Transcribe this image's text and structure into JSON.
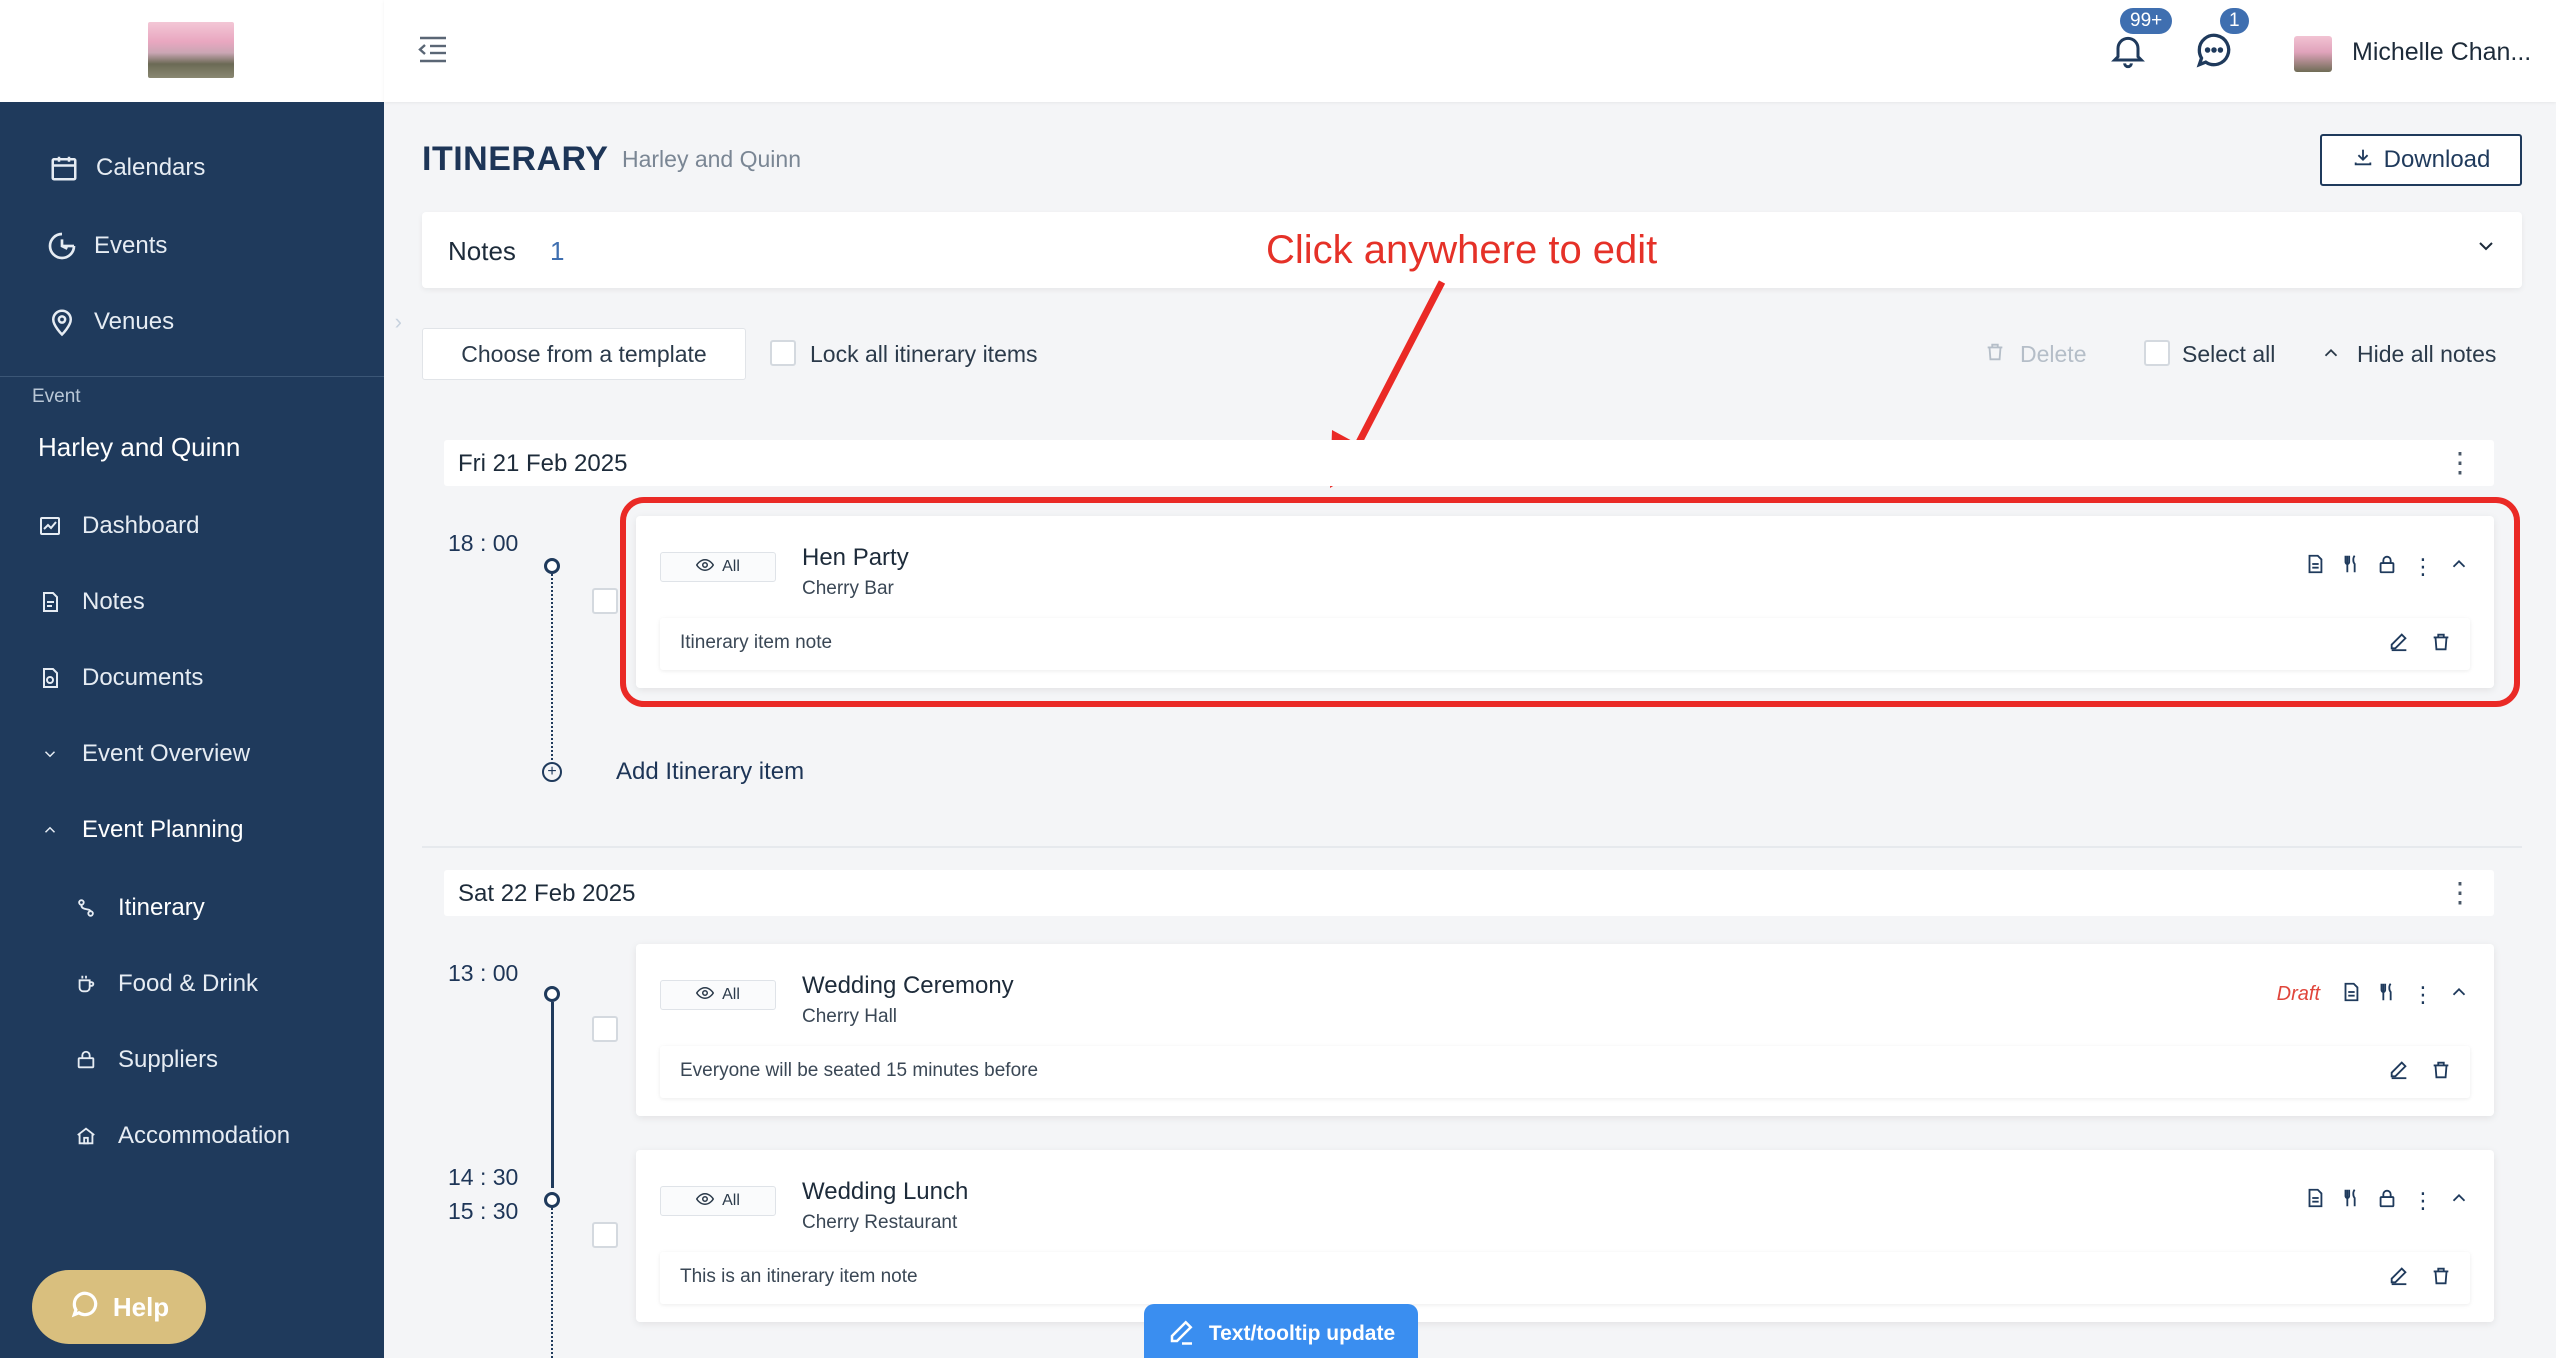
{
  "sidebar": {
    "nav": [
      {
        "label": "Calendars",
        "icon": "calendar-icon"
      },
      {
        "label": "Events",
        "icon": "events-icon"
      },
      {
        "label": "Venues",
        "icon": "location-pin-icon"
      }
    ],
    "section_label": "Event",
    "event_name": "Harley and Quinn",
    "event_nav": [
      {
        "label": "Dashboard",
        "icon": "dashboard-icon"
      },
      {
        "label": "Notes",
        "icon": "notes-icon"
      },
      {
        "label": "Documents",
        "icon": "documents-icon"
      },
      {
        "label": "Event Overview",
        "icon": "chevron-down-icon"
      },
      {
        "label": "Event Planning",
        "icon": "chevron-up-icon"
      }
    ],
    "planning_sub": [
      {
        "label": "Itinerary",
        "icon": "itinerary-icon"
      },
      {
        "label": "Food & Drink",
        "icon": "food-drink-icon"
      },
      {
        "label": "Suppliers",
        "icon": "suppliers-icon"
      },
      {
        "label": "Accommodation",
        "icon": "home-icon"
      }
    ],
    "help_label": "Help"
  },
  "topbar": {
    "notifications_badge": "99+",
    "messages_badge": "1",
    "user_name": "Michelle Chan..."
  },
  "page": {
    "title": "ITINERARY",
    "subtitle": "Harley and Quinn",
    "download_label": "Download"
  },
  "notes_bar": {
    "label": "Notes",
    "count": "1"
  },
  "annotation": {
    "text": "Click anywhere to edit"
  },
  "toolbar": {
    "template_label": "Choose from a template",
    "lock_label": "Lock all itinerary items",
    "delete_label": "Delete",
    "select_all_label": "Select all",
    "hide_notes_label": "Hide all notes"
  },
  "days": [
    {
      "date": "Fri 21 Feb 2025",
      "items": [
        {
          "time": "18 : 00",
          "visibility": "All",
          "title": "Hen Party",
          "venue": "Cherry Bar",
          "note": "Itinerary item note",
          "draft": ""
        }
      ],
      "add_label": "Add Itinerary item"
    },
    {
      "date": "Sat 22 Feb 2025",
      "items": [
        {
          "time": "13 : 00",
          "visibility": "All",
          "title": "Wedding Ceremony",
          "venue": "Cherry Hall",
          "note": "Everyone will be seated 15 minutes before",
          "draft": "Draft"
        },
        {
          "time": "14 : 30",
          "time_end": "15 : 30",
          "visibility": "All",
          "title": "Wedding Lunch",
          "venue": "Cherry Restaurant",
          "note": "This is an itinerary item note",
          "draft": ""
        }
      ]
    }
  ],
  "tooltip_button": {
    "label": "Text/tooltip update"
  },
  "colors": {
    "sidebar": "#1f3a5c",
    "accent": "#3f6fb0",
    "annotation": "#e53128",
    "help": "#d9bf7e",
    "tooltip": "#3a8ef0"
  }
}
